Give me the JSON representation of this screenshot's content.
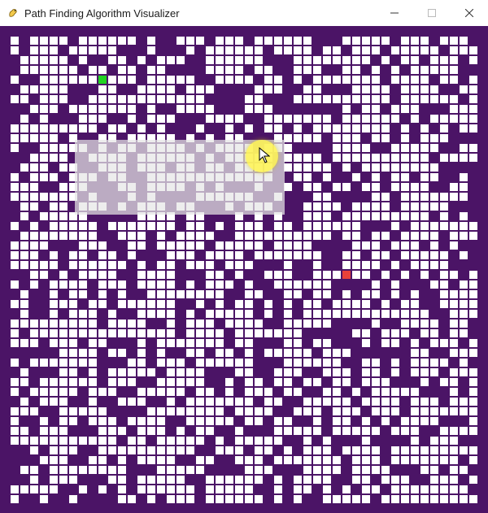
{
  "window": {
    "title": "Path Finding Algorithm Visualizer",
    "icons": {
      "app": "pygame-snake-icon",
      "minimize": "minimize-icon",
      "maximize": "maximize-icon",
      "close": "close-icon"
    }
  },
  "grid": {
    "rows": 50,
    "cols": 50,
    "colors": {
      "background": "#4b1466",
      "open": "#ffffff",
      "barrier": "#4b1466",
      "start": "#22d322",
      "end": "#e8413a"
    },
    "start": {
      "row": 5,
      "col": 10
    },
    "end": {
      "row": 25,
      "col": 35
    },
    "barrier_density": 0.33
  },
  "overlay": {
    "cursor_icon": "mouse-pointer-icon",
    "highlight": "cursor-highlight"
  }
}
